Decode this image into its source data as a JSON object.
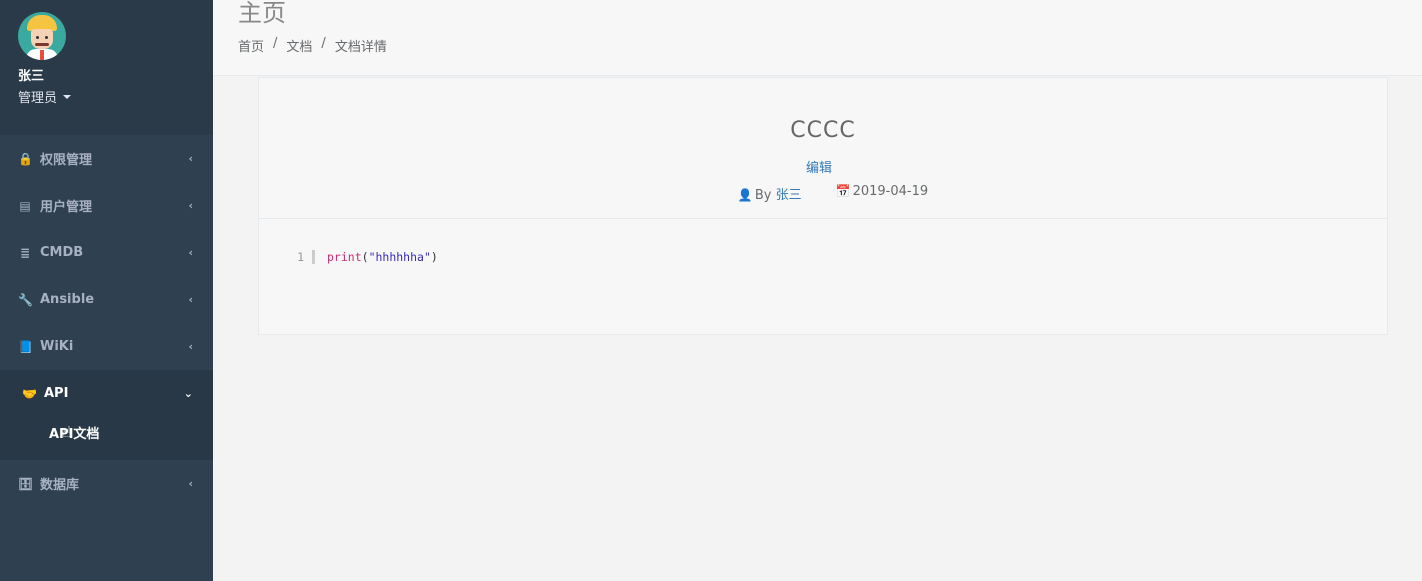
{
  "profile": {
    "name": "张三",
    "role": "管理员"
  },
  "menu": [
    {
      "label": "权限管理",
      "icon": "lock-icon",
      "glyph": "🔒"
    },
    {
      "label": "用户管理",
      "icon": "id-card-icon",
      "glyph": "▤"
    },
    {
      "label": "CMDB",
      "icon": "server-icon",
      "glyph": "≣"
    },
    {
      "label": "Ansible",
      "icon": "wrench-icon",
      "glyph": "🔧"
    },
    {
      "label": "WiKi",
      "icon": "book-icon",
      "glyph": "📘"
    }
  ],
  "api_menu": {
    "label": "API",
    "icon": "handshake-icon",
    "glyph": "🤝",
    "sub_label": "API文档"
  },
  "db_menu": {
    "label": "数据库",
    "icon": "database-icon",
    "glyph": "🗄"
  },
  "header": {
    "title": "主页",
    "breadcrumb": [
      "首页",
      "文档",
      "文档详情"
    ]
  },
  "doc": {
    "title": "CCCC",
    "edit_label": "编辑",
    "by_label": "By",
    "author": "张三",
    "date": "2019-04-19",
    "code": {
      "line_number": "1",
      "func": "print",
      "open": "(",
      "string": "\"hhhhhha\"",
      "close": ")"
    }
  },
  "colors": {
    "sidebar": "#2f4050",
    "link": "#337ab7",
    "keyword": "#c92c74",
    "string": "#3a2bb5"
  }
}
